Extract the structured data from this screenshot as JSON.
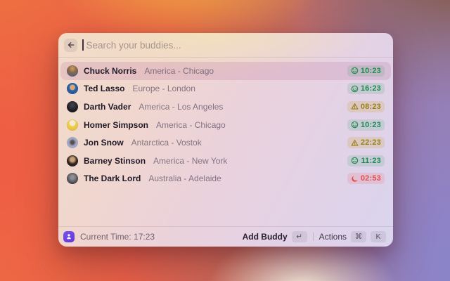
{
  "window": {
    "search": {
      "placeholder": "Search your buddies..."
    },
    "list": {
      "rows": [
        {
          "name": "Chuck Norris",
          "location": "America - Chicago",
          "time": "10:23",
          "status": "smiley",
          "selected": true
        },
        {
          "name": "Ted Lasso",
          "location": "Europe - London",
          "time": "16:23",
          "status": "smiley",
          "selected": false
        },
        {
          "name": "Darth Vader",
          "location": "America - Los Angeles",
          "time": "08:23",
          "status": "warning",
          "selected": false
        },
        {
          "name": "Homer Simpson",
          "location": "America - Chicago",
          "time": "10:23",
          "status": "smiley",
          "selected": false
        },
        {
          "name": "Jon Snow",
          "location": "Antarctica - Vostok",
          "time": "22:23",
          "status": "warning",
          "selected": false
        },
        {
          "name": "Barney Stinson",
          "location": "America - New York",
          "time": "11:23",
          "status": "smiley",
          "selected": false
        },
        {
          "name": "The Dark Lord",
          "location": "Australia - Adelaide",
          "time": "02:53",
          "status": "moon",
          "selected": false
        }
      ]
    },
    "footer": {
      "current_time": "Current Time: 17:23",
      "add_buddy_label": "Add Buddy",
      "add_buddy_key": "↵",
      "actions_label": "Actions",
      "actions_keys": [
        "⌘",
        "K"
      ]
    },
    "colors": {
      "status_smiley": "#1f8a50",
      "status_warning": "#99801f",
      "status_moon": "#e44e4b",
      "footer_icon_bg": "#6d48e0"
    }
  }
}
